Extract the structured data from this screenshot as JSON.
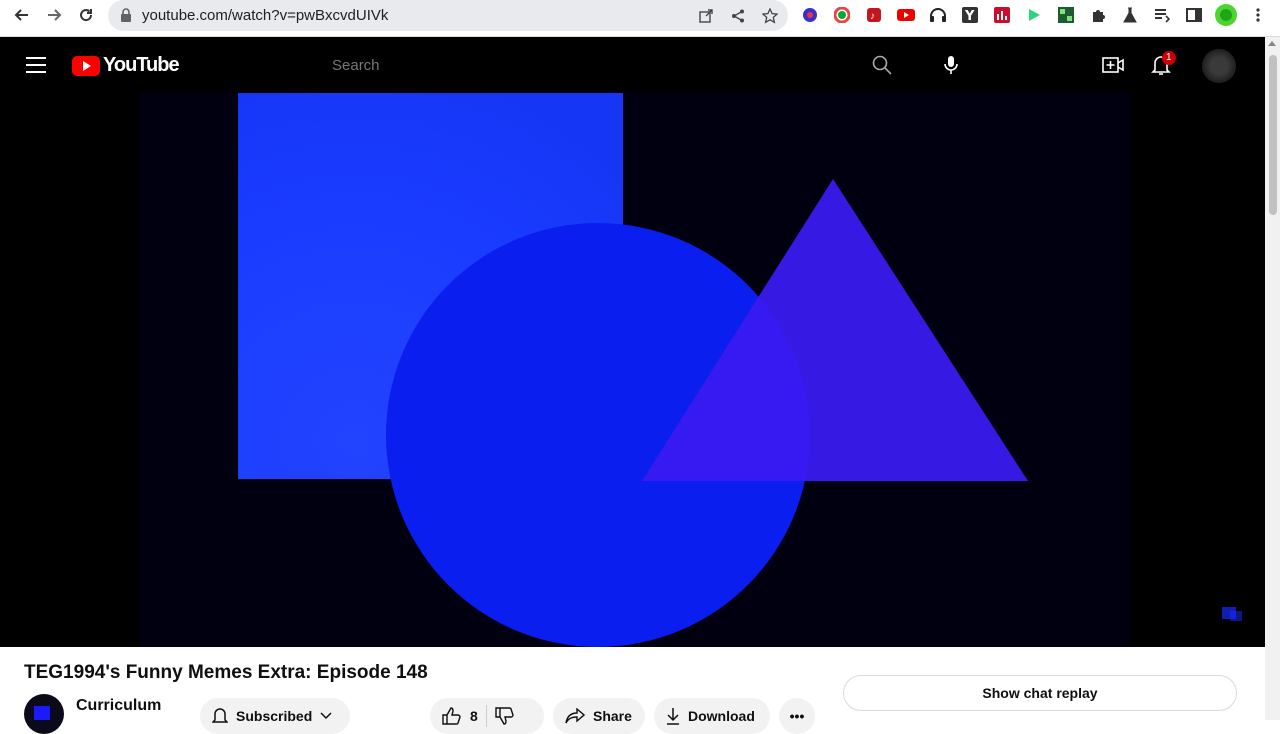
{
  "browser": {
    "url": "youtube.com/watch?v=pwBxcvdUIVk"
  },
  "youtube": {
    "logo_text": "YouTube",
    "search_placeholder": "Search",
    "notification_count": "1"
  },
  "video": {
    "title": "TEG1994's Funny Memes Extra: Episode 148",
    "channel": "Curriculum",
    "subscribed_label": "Subscribed",
    "like_count": "8",
    "share_label": "Share",
    "download_label": "Download",
    "more_label": "•••",
    "chat_replay_label": "Show chat replay"
  },
  "colors": {
    "square": "#1a3cff",
    "circle": "#0a1ef0",
    "triangle": "#3a1af0",
    "youtube_red": "#ff0000"
  }
}
